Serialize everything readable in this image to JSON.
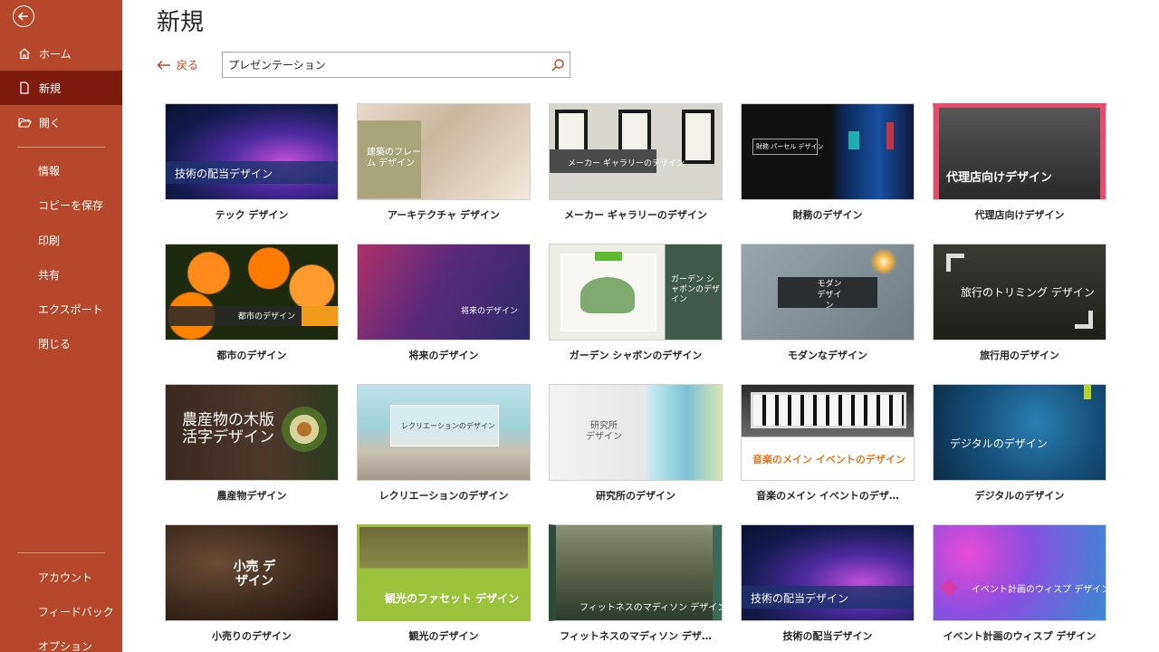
{
  "sidebar": {
    "items": [
      {
        "label": "ホーム",
        "icon": "home-icon"
      },
      {
        "label": "新規",
        "icon": "new-document-icon",
        "active": true
      },
      {
        "label": "開く",
        "icon": "folder-open-icon"
      },
      {
        "label": "情報"
      },
      {
        "label": "コピーを保存"
      },
      {
        "label": "印刷"
      },
      {
        "label": "共有"
      },
      {
        "label": "エクスポート"
      },
      {
        "label": "閉じる"
      },
      {
        "label": "アカウント"
      },
      {
        "label": "フィードバック"
      },
      {
        "label": "オプション"
      }
    ]
  },
  "header": {
    "title": "新規"
  },
  "back_link": {
    "label": "戻る"
  },
  "search": {
    "value": "プレゼンテーション"
  },
  "templates": [
    {
      "caption": "テック デザイン",
      "thumb_text": "技術の配当デザイン"
    },
    {
      "caption": "アーキテクチャ デザイン",
      "thumb_text": "建築のフレーム デザイン"
    },
    {
      "caption": "メーカー ギャラリーのデザイン",
      "thumb_text": "メーカー ギャラリーのデザイン"
    },
    {
      "caption": "財務のデザイン",
      "thumb_text": "財務 パーセル デザイン"
    },
    {
      "caption": "代理店向けデザイン",
      "thumb_text": "代理店向けデザイン"
    },
    {
      "caption": "都市のデザイン",
      "thumb_text": "都市のデザイン"
    },
    {
      "caption": "将来のデザイン",
      "thumb_text": "将来のデザイン"
    },
    {
      "caption": "ガーデン シャボンのデザイン",
      "thumb_text": "ガーデン シャボンのデザイン"
    },
    {
      "caption": "モダンなデザイン",
      "thumb_text": "モダン デザイン"
    },
    {
      "caption": "旅行用のデザイン",
      "thumb_text": "旅行のトリミング デザイン"
    },
    {
      "caption": "農産物デザイン",
      "thumb_text": "農産物の木版 活字デザイン"
    },
    {
      "caption": "レクリエーションのデザイン",
      "thumb_text": "レクリエーションのデザイン"
    },
    {
      "caption": "研究所のデザイン",
      "thumb_text": "研究所 デザイン"
    },
    {
      "caption": "音楽のメイン イベントのデザ…",
      "thumb_text": "音楽のメイン イベントのデザイン"
    },
    {
      "caption": "デジタルのデザイン",
      "thumb_text": "デジタルのデザイン"
    },
    {
      "caption": "小売りのデザイン",
      "thumb_text": "小売 デザイン"
    },
    {
      "caption": "観光のデザイン",
      "thumb_text": "観光のファセット デザイン"
    },
    {
      "caption": "フィットネスのマディソン デザ…",
      "thumb_text": "フィットネスのマディソン デザイン"
    },
    {
      "caption": "技術の配当デザイン",
      "thumb_text": "技術の配当デザイン"
    },
    {
      "caption": "イベント計画のウィスプ デザイン",
      "thumb_text": "イベント計画のウィスプ デザイン"
    }
  ],
  "colors": {
    "sidebar": "#b7472a",
    "sidebar_active": "#7c1c0e",
    "accent": "#b7472a"
  }
}
